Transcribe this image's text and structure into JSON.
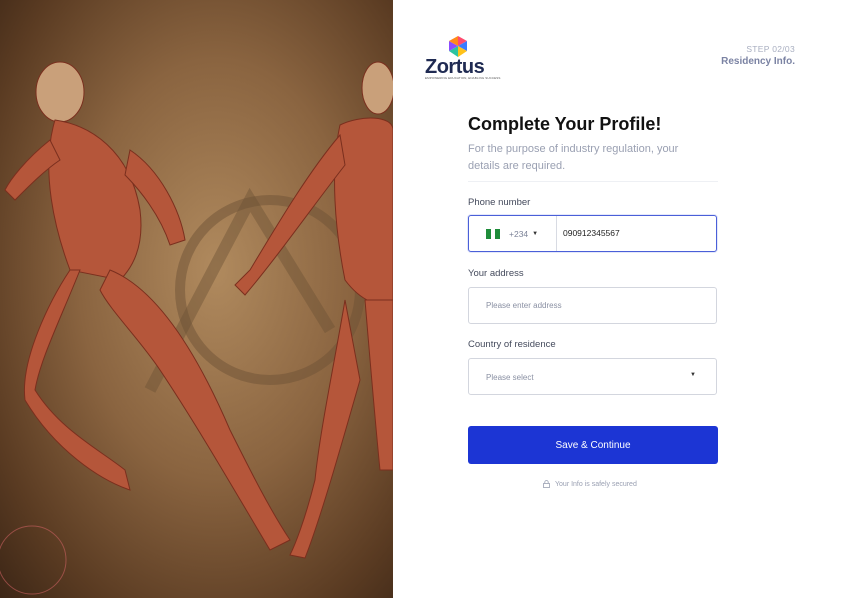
{
  "brand": {
    "name": "Zortus",
    "tagline": "EMPOWERING EDUCATION, ENABLING SUCCESS"
  },
  "step": {
    "label": "STEP 02/03",
    "name": "Residency Info."
  },
  "form": {
    "title": "Complete Your Profile!",
    "subtitle": "For the purpose of industry regulation, your details are required.",
    "phone": {
      "label": "Phone number",
      "country_code": "+234",
      "flag": "nigeria-flag-icon",
      "value": "090912345567"
    },
    "address": {
      "label": "Your address",
      "placeholder": "Please enter address"
    },
    "country": {
      "label": "Country of residence",
      "value": "Please select"
    },
    "submit_label": "Save & Continue",
    "secure_note": "Your Info is safely secured"
  },
  "colors": {
    "primary": "#1c35d4",
    "focus_border": "#4a5fd8",
    "flag_green": "#1e8c3a"
  }
}
